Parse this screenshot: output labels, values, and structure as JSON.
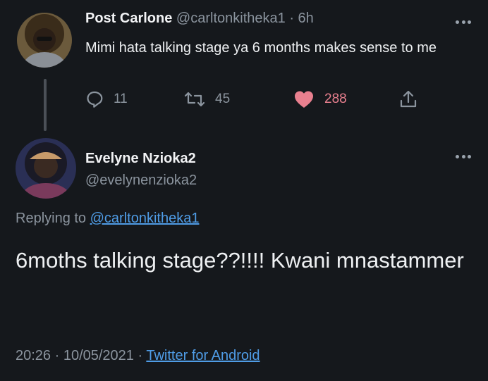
{
  "tweet1": {
    "display_name": "Post Carlone",
    "handle": "@carltonkitheka1",
    "separator": "·",
    "time": "6h",
    "text": "Mimi hata talking stage ya 6 months makes sense to me",
    "reply_count": "11",
    "retweet_count": "45",
    "like_count": "288",
    "icons": [
      "reply-icon",
      "retweet-icon",
      "heart-icon",
      "share-icon",
      "more-icon"
    ]
  },
  "tweet2": {
    "display_name": "Evelyne Nzioka2",
    "handle": "@evelynenzioka2",
    "replying_prefix": "Replying to",
    "replying_handle": "@carltonkitheka1",
    "text": "6moths talking stage??!!!! Kwani mnastammer",
    "timestamp": "20:26 · 10/05/2021",
    "separator": "·",
    "source": "Twitter for Android"
  },
  "colors": {
    "background": "#15181c",
    "secondary_text": "#8b949e",
    "link": "#4f9ce6",
    "like": "#e9808f"
  }
}
